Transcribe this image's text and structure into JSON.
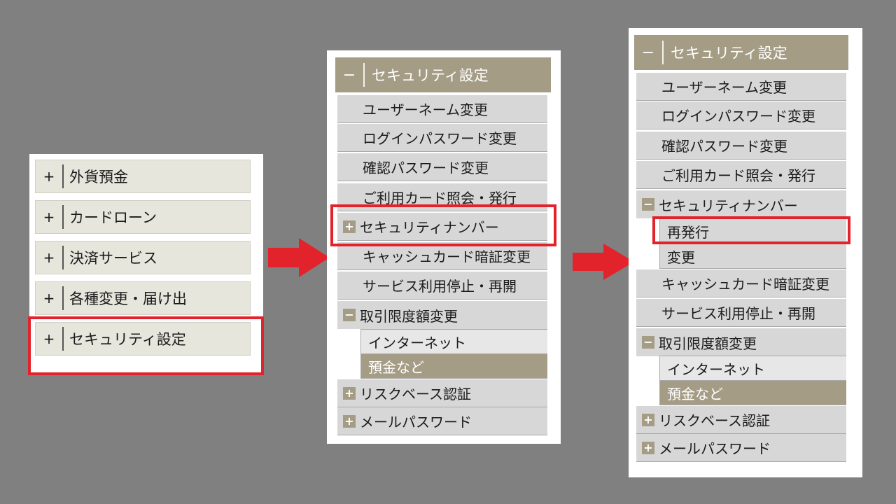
{
  "colors": {
    "accent": "#a59c86",
    "highlight": "#e3232b",
    "row_bg": "#d7d7d7"
  },
  "step1": {
    "items": [
      {
        "toggle": "+",
        "label": "外貨預金"
      },
      {
        "toggle": "+",
        "label": "カードローン"
      },
      {
        "toggle": "+",
        "label": "決済サービス"
      },
      {
        "toggle": "+",
        "label": "各種変更・届け出"
      },
      {
        "toggle": "+",
        "label": "セキュリティ設定"
      }
    ]
  },
  "step2": {
    "header": {
      "toggle": "−",
      "label": "セキュリティ設定"
    },
    "rows": [
      "ユーザーネーム変更",
      "ログインパスワード変更",
      "確認パスワード変更",
      "ご利用カード照会・発行"
    ],
    "security_number": {
      "toggle": "+",
      "label": "セキュリティナンバー"
    },
    "rows2": [
      "キャッシュカード暗証変更",
      "サービス利用停止・再開"
    ],
    "limit": {
      "toggle": "−",
      "label": "取引限度額変更",
      "subs": [
        "インターネット",
        "預金など"
      ]
    },
    "risk": {
      "toggle": "+",
      "label": "リスクベース認証"
    },
    "mail": {
      "toggle": "+",
      "label": "メールパスワード"
    }
  },
  "step3": {
    "header": {
      "toggle": "−",
      "label": "セキュリティ設定"
    },
    "rows": [
      "ユーザーネーム変更",
      "ログインパスワード変更",
      "確認パスワード変更",
      "ご利用カード照会・発行"
    ],
    "security_number": {
      "toggle": "−",
      "label": "セキュリティナンバー",
      "subs": [
        "再発行",
        "変更"
      ]
    },
    "rows2": [
      "キャッシュカード暗証変更",
      "サービス利用停止・再開"
    ],
    "limit": {
      "toggle": "−",
      "label": "取引限度額変更",
      "subs": [
        "インターネット",
        "預金など"
      ]
    },
    "risk": {
      "toggle": "+",
      "label": "リスクベース認証"
    },
    "mail": {
      "toggle": "+",
      "label": "メールパスワード"
    }
  }
}
